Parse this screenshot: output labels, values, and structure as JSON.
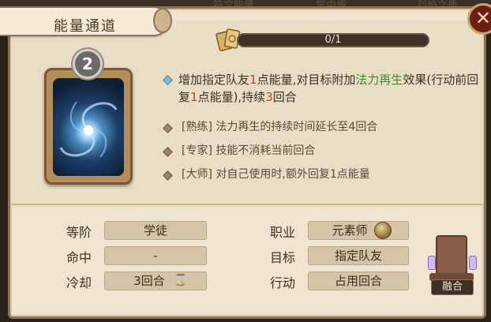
{
  "top_tabs": [
    "符文能量",
    "掌中盾",
    "烈焰之盾"
  ],
  "title": "能量通道",
  "close_label": "✕",
  "progress": {
    "text": "0/1",
    "value": 0
  },
  "card": {
    "rank": "2"
  },
  "effect": {
    "main_parts": [
      {
        "t": "增加指定队友",
        "c": ""
      },
      {
        "t": "1",
        "c": "red"
      },
      {
        "t": "点能量,对目标附加",
        "c": ""
      },
      {
        "t": "法力再生",
        "c": "green"
      },
      {
        "t": "效果(行动前回复",
        "c": ""
      },
      {
        "t": "1",
        "c": "red"
      },
      {
        "t": "点能量),持续",
        "c": ""
      },
      {
        "t": "3",
        "c": "red"
      },
      {
        "t": "回合",
        "c": ""
      }
    ],
    "upgrades": [
      "[熟练] 法力再生的持续时间延长至4回合",
      "[专家] 技能不消耗当前回合",
      "[大师] 对自己使用时,额外回复1点能量"
    ]
  },
  "stats": {
    "tier_label": "等阶",
    "tier_value": "学徒",
    "hit_label": "命中",
    "hit_value": "-",
    "cooldown_label": "冷却",
    "cooldown_value": "3回合",
    "class_label": "职业",
    "class_value": "元素师",
    "target_label": "目标",
    "target_value": "指定队友",
    "action_label": "行动",
    "action_value": "占用回合"
  },
  "fuse_label": "融合",
  "colors": {
    "highlight_red": "#c4462d",
    "highlight_green": "#3f8a2c",
    "accent_gold": "#c9a44c"
  }
}
